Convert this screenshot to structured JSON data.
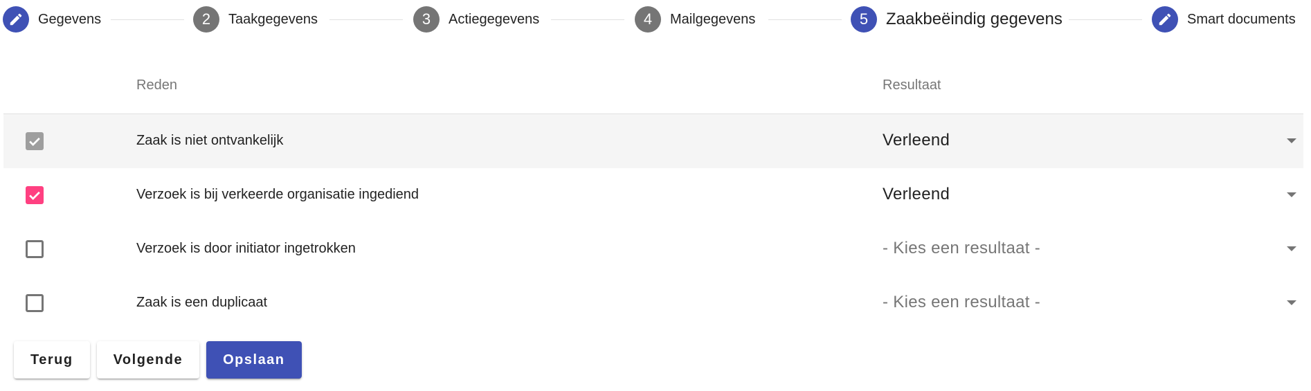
{
  "stepper": {
    "steps": [
      {
        "label": "Gegevens",
        "marker": "",
        "icon": "pencil-icon",
        "state": "edit"
      },
      {
        "label": "Taakgegevens",
        "marker": "2",
        "state": "number"
      },
      {
        "label": "Actiegegevens",
        "marker": "3",
        "state": "number"
      },
      {
        "label": "Mailgegevens",
        "marker": "4",
        "state": "number"
      },
      {
        "label": "Zaakbeëindig gegevens",
        "marker": "5",
        "state": "active"
      },
      {
        "label": "Smart documents",
        "marker": "",
        "icon": "pencil-icon",
        "state": "edit"
      }
    ]
  },
  "table": {
    "headers": {
      "reason": "Reden",
      "result": "Resultaat"
    },
    "rows": [
      {
        "reason": "Zaak is niet ontvankelijk",
        "checked": true,
        "disabled": true,
        "result": "Verleend",
        "is_placeholder": false
      },
      {
        "reason": "Verzoek is bij verkeerde organisatie ingediend",
        "checked": true,
        "disabled": false,
        "result": "Verleend",
        "is_placeholder": false
      },
      {
        "reason": "Verzoek is door initiator ingetrokken",
        "checked": false,
        "disabled": false,
        "result": "- Kies een resultaat -",
        "is_placeholder": true
      },
      {
        "reason": "Zaak is een duplicaat",
        "checked": false,
        "disabled": false,
        "result": "- Kies een resultaat -",
        "is_placeholder": true
      }
    ]
  },
  "actions": {
    "back_label": "Terug",
    "next_label": "Volgende",
    "save_label": "Opslaan"
  },
  "colors": {
    "primary": "#3f51b5",
    "accent": "#ff4081",
    "disabled_check": "#9e9e9e",
    "step_inactive": "#757575"
  }
}
